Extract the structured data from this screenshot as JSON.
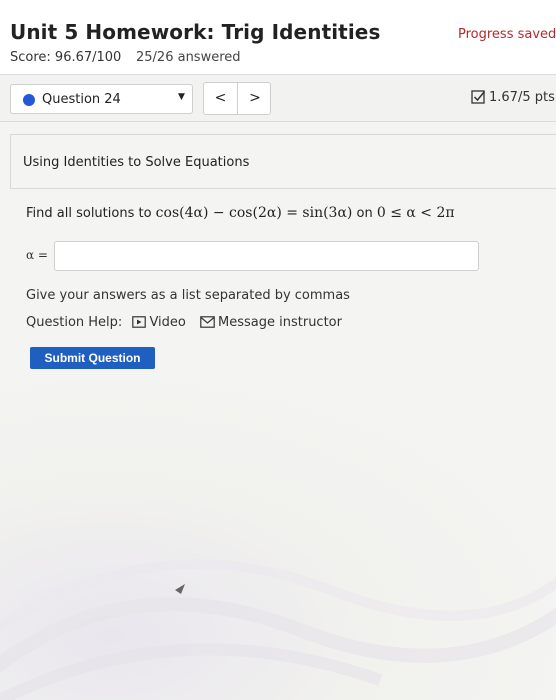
{
  "header": {
    "title": "Unit 5 Homework: Trig Identities",
    "score": "Score: 96.67/100",
    "answered": "25/26 answered",
    "progress_status": "Progress saved"
  },
  "question_bar": {
    "selected_question": "Question 24",
    "prev_glyph": "<",
    "next_glyph": ">",
    "points": "1.67/5 pts"
  },
  "section": {
    "title": "Using Identities to Solve Equations"
  },
  "question": {
    "prefix": "Find all solutions to ",
    "equation": "cos(4α) − cos(2α) = sin(3α)",
    "on_word": " on ",
    "range": "0 ≤ α < 2π",
    "answer_label": "α =",
    "answer_value": ""
  },
  "instructions": {
    "hint": "Give your answers as a list separated by commas",
    "help_label": "Question Help:",
    "video_label": "Video",
    "message_label": "Message instructor"
  },
  "actions": {
    "submit_label": "Submit Question"
  },
  "colors": {
    "accent_blue": "#1f5fbf",
    "progress_red": "#b32a2a",
    "question_dot": "#2458d6"
  }
}
